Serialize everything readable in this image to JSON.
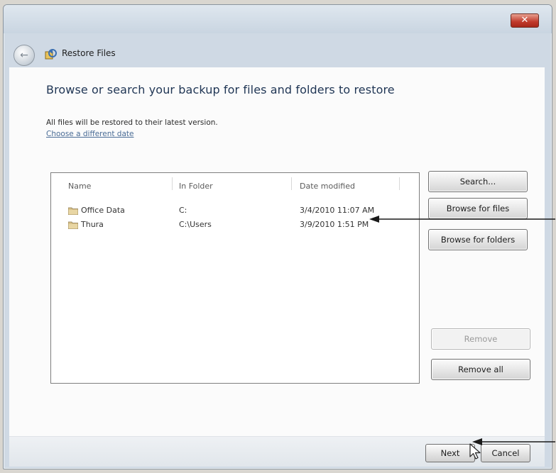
{
  "window": {
    "title": "Restore Files",
    "close_glyph": "✕",
    "back_glyph": "←"
  },
  "main": {
    "heading": "Browse or search your backup for files and folders to restore",
    "info_text": "All files will be restored to their latest version.",
    "date_link": "Choose a different date"
  },
  "list": {
    "columns": [
      "Name",
      "In Folder",
      "Date modified"
    ],
    "rows": [
      {
        "name": "Office Data",
        "folder": "C:",
        "date": "3/4/2010 11:07 AM"
      },
      {
        "name": "Thura",
        "folder": "C:\\Users",
        "date": "3/9/2010 1:51 PM"
      }
    ]
  },
  "side_buttons": {
    "search": "Search...",
    "browse_files": "Browse for files",
    "browse_folders": "Browse for folders",
    "remove": "Remove",
    "remove_all": "Remove all"
  },
  "footer": {
    "next": "Next",
    "cancel": "Cancel"
  },
  "icons": {
    "back": "back-arrow-icon",
    "app": "restore-files-icon",
    "folder": "folder-icon",
    "close": "close-icon",
    "cursor": "mouse-cursor-icon"
  },
  "colors": {
    "heading": "#1f3554",
    "link": "#4a6c96",
    "close_button": "#c0392b"
  }
}
